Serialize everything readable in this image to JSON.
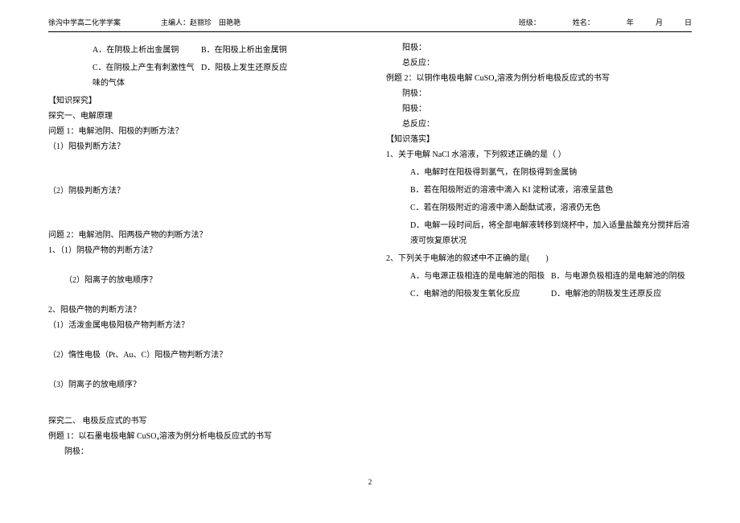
{
  "header": {
    "school": "徐沟中学高二化学学案",
    "editor_label": "主编人：",
    "editors": "赵丽珍　田艳艳",
    "class_label": "班级：",
    "name_label": "姓名：",
    "year_label": "年",
    "month_label": "月",
    "day_label": "日"
  },
  "q1": {
    "opts": {
      "a": "A．在阴极上析出金属铜",
      "b": "B．在阳极上析出金属铜",
      "c": "C．在阴极上产生有刺激性气味的气体",
      "d": "D．阳极上发生还原反应"
    }
  },
  "sect_inquiry": "【知识探究】",
  "inq1_title": "探究一、电解原理",
  "p1_title": "问题 1：电解池阴、阳极的判断方法？",
  "p1_1": "（1）阳极判断方法？",
  "p1_2": "（2）阴极判断方法？",
  "p2_title": "问题 2：电解池阴、阳两极产物的判断方法？",
  "p2_1": "1、（1）阴极产物的判断方法？",
  "p2_1b": "（2）阳离子的放电顺序？",
  "p2_2": "2、阳极产物的判断方法？",
  "p2_2a": "（1）活泼金属电极阳极产物判断方法？",
  "p2_2b": "（2）惰性电极（Pt、Au、C）阳极产物判断方法？",
  "p2_2c": "（3）阴离子的放电顺序？",
  "inq2_title": "探究二、 电极反应式的书写",
  "ex1_title": "例题 1：以石墨电极电解 CuSO₄溶液为例分析电极反应式的书写",
  "ex2_title": "例题 2：以铜作电极电解 CuSO₄溶液为例分析电极反应式的书写",
  "electrode_neg": "阴极：",
  "electrode_pos": "阳极：",
  "react_total": "总反应：",
  "sect_practice": "【知识落实】",
  "prac1": {
    "stem": "1、关于电解 NaCl 水溶液，下列叙述正确的是（   ）",
    "a": "A．电解时在阳极得到氯气，在阴极得到金属钠",
    "b": "B．若在阳极附近的溶液中滴入 KI 淀粉试液，溶液呈蓝色",
    "c": "C．若在阴极附近的溶液中滴入酚酞试液，溶液仍无色",
    "d": "D．电解一段时间后，将全部电解液转移到烧杯中，加入适量盐酸充分搅拌后溶液可恢复原状况"
  },
  "prac2": {
    "stem": "2、下列关于电解池的叙述中不正确的是(　　)",
    "a": "A．与电源正极相连的是电解池的阳极",
    "b": "B．与电源负极相连的是电解池的阴极",
    "c": "C．电解池的阳极发生氧化反应",
    "d": "D．电解池的阴极发生还原反应"
  },
  "page_number": "2"
}
